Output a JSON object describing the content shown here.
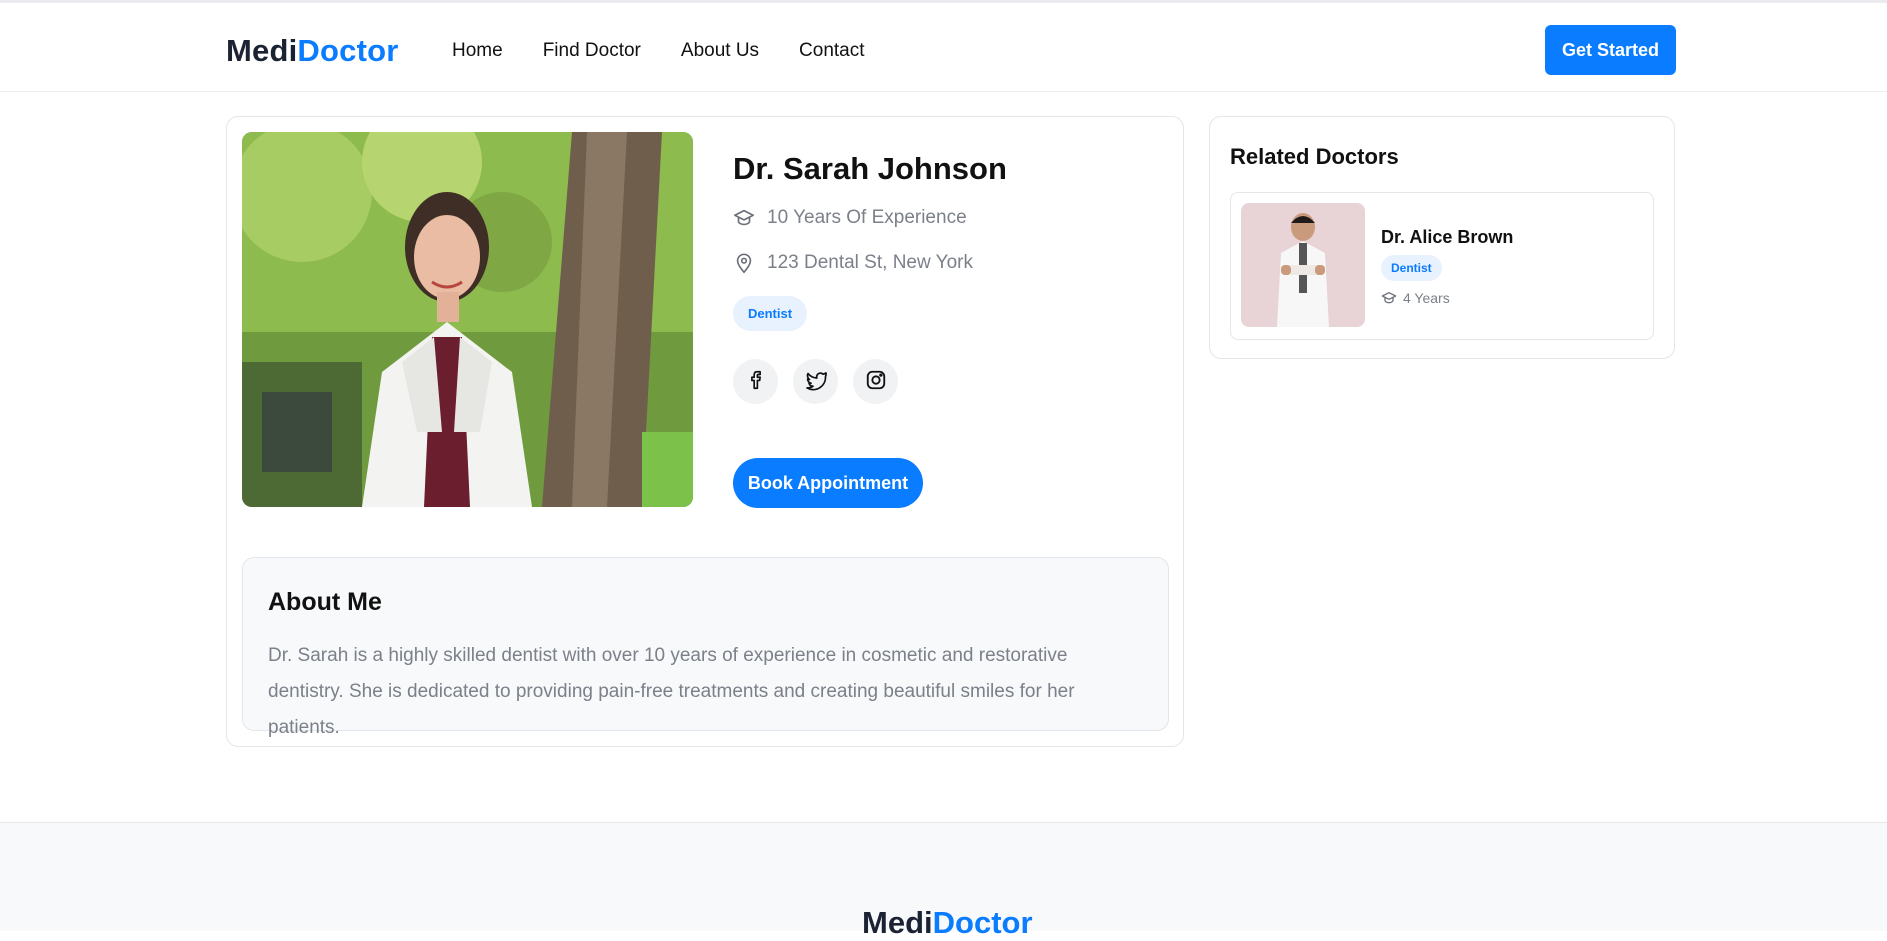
{
  "brand": {
    "part1": "Medi",
    "part2": "Doctor"
  },
  "nav": {
    "items": [
      "Home",
      "Find Doctor",
      "About Us",
      "Contact"
    ],
    "cta_label": "Get Started"
  },
  "doctor": {
    "name": "Dr. Sarah Johnson",
    "experience": "10 Years Of Experience",
    "location": "123 Dental St, New York",
    "specialty": "Dentist",
    "book_label": "Book Appointment"
  },
  "about": {
    "title": "About Me",
    "text": "Dr. Sarah is a highly skilled dentist with over 10 years of experience in cosmetic and restorative dentistry. She is dedicated to providing pain-free treatments and creating beautiful smiles for her patients."
  },
  "related": {
    "title": "Related Doctors",
    "items": [
      {
        "name": "Dr. Alice Brown",
        "specialty": "Dentist",
        "years": "4 Years"
      }
    ]
  },
  "footer": {
    "brand_part1": "Medi",
    "brand_part2": "Doctor"
  },
  "colors": {
    "accent": "#0a7cff",
    "tag_bg": "#e8f2ff",
    "muted_text": "#7b8089"
  },
  "icons": [
    "graduation-cap-icon",
    "location-pin-icon",
    "facebook-icon",
    "twitter-icon",
    "instagram-icon"
  ]
}
